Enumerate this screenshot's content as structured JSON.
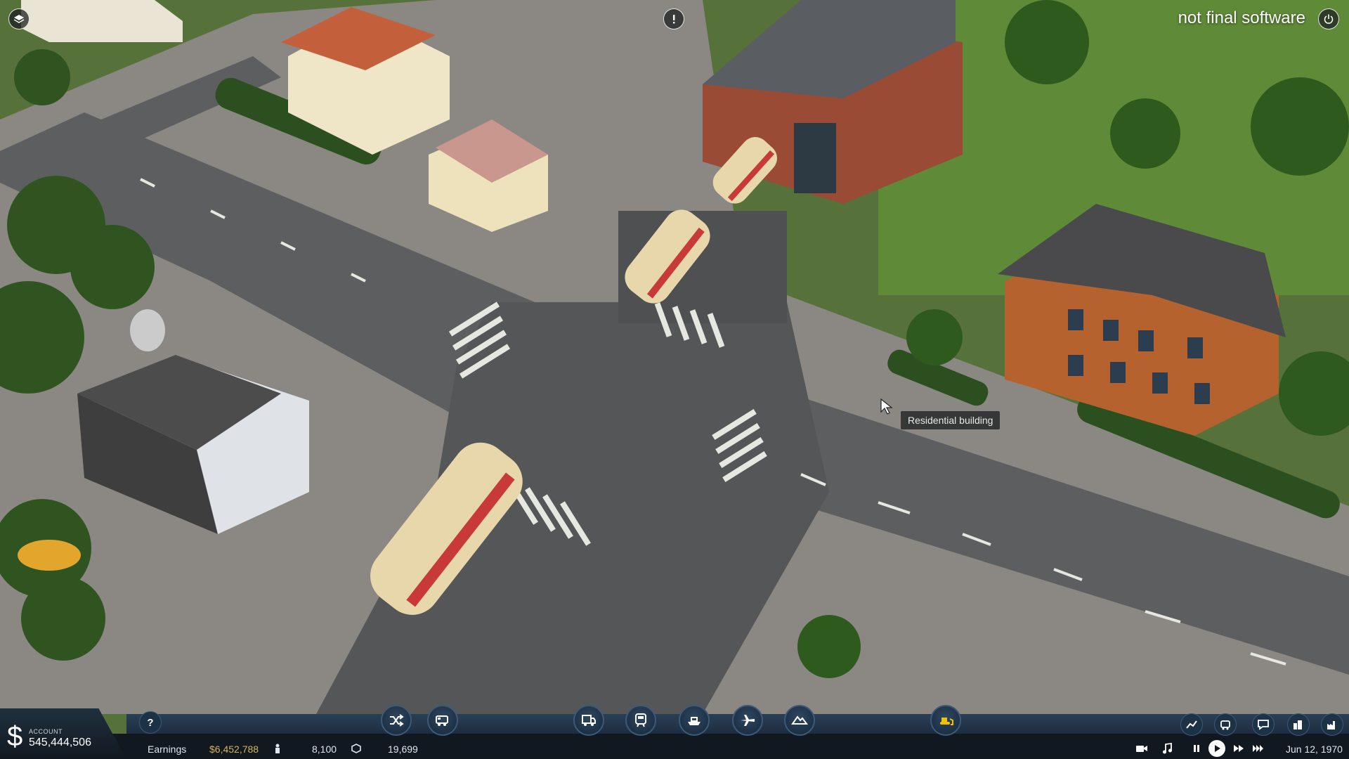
{
  "watermark": "not final software",
  "tooltip": "Residential building",
  "account": {
    "label": "ACCOUNT",
    "value": "545,444,506"
  },
  "stats": {
    "earnings_label": "Earnings",
    "earnings_value": "$6,452,788",
    "population_value": "8,100",
    "cargo_value": "19,699"
  },
  "date": "Jun 12, 1970",
  "icons": {
    "top_left": "layers-icon",
    "top_center": "alert-icon",
    "top_right": "power-icon",
    "help": "help-icon",
    "tools_left": [
      "shuffle-icon",
      "bus-icon"
    ],
    "tools_center": [
      "truck-icon",
      "train-icon",
      "ship-icon",
      "plane-icon",
      "terrain-icon"
    ],
    "tools_bulldoze": "bulldozer-icon",
    "tools_right": [
      "graph-icon",
      "vehicle-list-icon",
      "messages-icon",
      "town-icon",
      "industry-icon"
    ],
    "controls": [
      "camera-icon",
      "music-icon",
      "pause-icon",
      "play-icon",
      "fast-forward-icon",
      "fastest-forward-icon"
    ]
  },
  "colors": {
    "bar": "#1d2d40",
    "accent": "#3d5a78",
    "earnings": "#d4b25a"
  }
}
